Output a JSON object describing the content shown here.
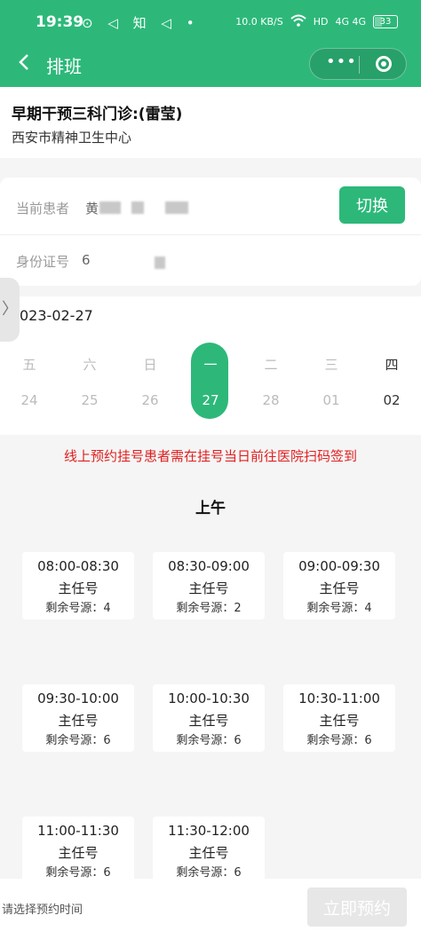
{
  "status_bar": {
    "time": "19:39",
    "app_icons": "⊙ ◁ 知 ◁ •",
    "net_speed": "10.0 KB/S",
    "hd": "HD",
    "signal": "4G 4G",
    "battery": "33"
  },
  "header": {
    "title": "排班",
    "more_label": "•••"
  },
  "clinic": {
    "name": "早期干预三科门诊:(雷莹)",
    "hospital": "西安市精神卫生中心"
  },
  "patient": {
    "name_label": "当前患者",
    "name_value": "黄",
    "id_label": "身份证号",
    "id_value": "6",
    "switch_label": "切换"
  },
  "date": {
    "current": "023-02-27"
  },
  "days": [
    {
      "weekday": "五",
      "day": "24"
    },
    {
      "weekday": "六",
      "day": "25"
    },
    {
      "weekday": "日",
      "day": "26"
    },
    {
      "weekday": "一",
      "day": "27"
    },
    {
      "weekday": "二",
      "day": "28"
    },
    {
      "weekday": "三",
      "day": "01"
    },
    {
      "weekday": "四",
      "day": "02"
    }
  ],
  "notice": "线上预约挂号患者需在挂号当日前往医院扫码签到",
  "period": "上午",
  "slots": [
    {
      "time": "08:00-08:30",
      "kind": "主任号",
      "remain": "剩余号源：4"
    },
    {
      "time": "08:30-09:00",
      "kind": "主任号",
      "remain": "剩余号源：2"
    },
    {
      "time": "09:00-09:30",
      "kind": "主任号",
      "remain": "剩余号源：4"
    },
    {
      "time": "09:30-10:00",
      "kind": "主任号",
      "remain": "剩余号源：6"
    },
    {
      "time": "10:00-10:30",
      "kind": "主任号",
      "remain": "剩余号源：6"
    },
    {
      "time": "10:30-11:00",
      "kind": "主任号",
      "remain": "剩余号源：6"
    },
    {
      "time": "11:00-11:30",
      "kind": "主任号",
      "remain": "剩余号源：6"
    },
    {
      "time": "11:30-12:00",
      "kind": "主任号",
      "remain": "剩余号源：6"
    }
  ],
  "bottom": {
    "hint": "请选择预约时间",
    "book_label": "立即预约"
  },
  "colors": {
    "accent": "#2db87a",
    "notice": "#e02020"
  }
}
